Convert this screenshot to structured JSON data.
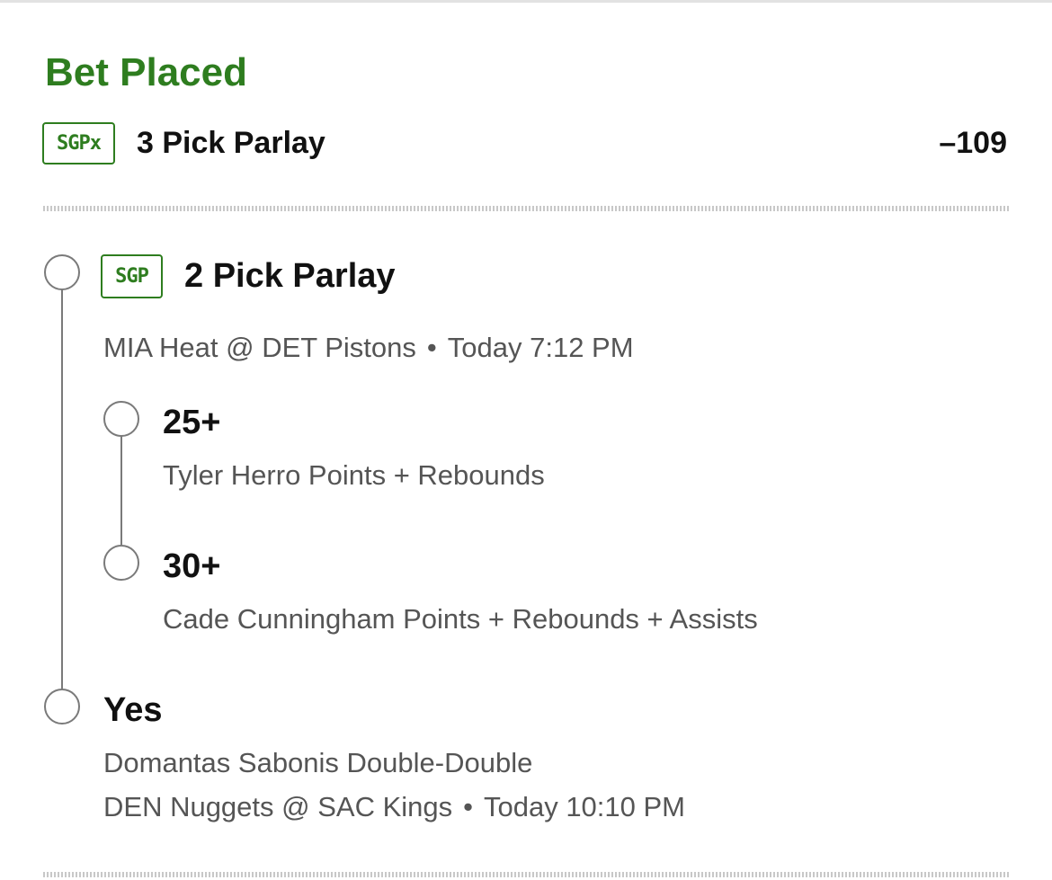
{
  "bet": {
    "status": "Bet Placed",
    "badge": "SGPx",
    "title": "3 Pick Parlay",
    "odds": "–109"
  },
  "sub_parlay": {
    "badge": "SGP",
    "title": "2 Pick Parlay",
    "game": {
      "matchup": "MIA Heat @ DET Pistons",
      "separator": "•",
      "time": "Today 7:12 PM"
    },
    "legs": [
      {
        "value": "25+",
        "description": "Tyler Herro Points + Rebounds"
      },
      {
        "value": "30+",
        "description": "Cade Cunningham Points + Rebounds + Assists"
      }
    ]
  },
  "single_leg": {
    "value": "Yes",
    "description": "Domantas Sabonis Double-Double",
    "game": {
      "matchup": "DEN Nuggets @ SAC Kings",
      "separator": "•",
      "time": "Today 10:10 PM"
    }
  },
  "colors": {
    "accent_green": "#2e7d1f",
    "timeline_gray": "#7a7a7a",
    "secondary_text": "#555555"
  }
}
